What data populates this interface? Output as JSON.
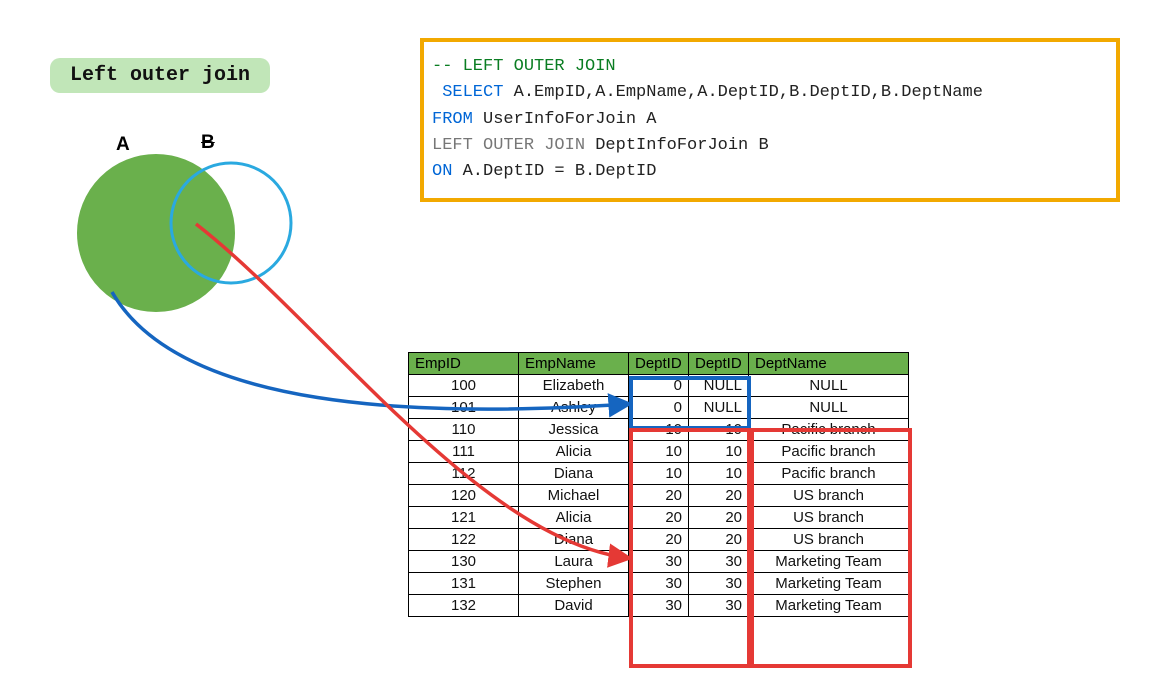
{
  "title": "Left outer join",
  "venn": {
    "labelA": "A",
    "labelB": "B"
  },
  "sql": {
    "comment": "-- LEFT OUTER JOIN",
    "select_kw": " SELECT",
    "select_cols": " A.EmpID,A.EmpName,A.DeptID,B.DeptID,B.DeptName",
    "from_kw": "FROM",
    "from_rest": " UserInfoForJoin A",
    "left_kw": "LEFT",
    "left_rest": " OUTER JOIN",
    "left_table": " DeptInfoForJoin B",
    "on_kw": "ON",
    "on_rest": " A.DeptID = B.DeptID"
  },
  "table": {
    "headers": {
      "c0": "EmpID",
      "c1": "EmpName",
      "c2": "DeptID",
      "c3": "DeptID",
      "c4": "DeptName"
    },
    "rows": [
      {
        "c0": "100",
        "c1": "Elizabeth",
        "c2": "0",
        "c3": "NULL",
        "c4": "NULL"
      },
      {
        "c0": "101",
        "c1": "Ashley",
        "c2": "0",
        "c3": "NULL",
        "c4": "NULL"
      },
      {
        "c0": "110",
        "c1": "Jessica",
        "c2": "10",
        "c3": "10",
        "c4": "Pacific branch"
      },
      {
        "c0": "111",
        "c1": "Alicia",
        "c2": "10",
        "c3": "10",
        "c4": "Pacific branch"
      },
      {
        "c0": "112",
        "c1": "Diana",
        "c2": "10",
        "c3": "10",
        "c4": "Pacific branch"
      },
      {
        "c0": "120",
        "c1": "Michael",
        "c2": "20",
        "c3": "20",
        "c4": "US branch"
      },
      {
        "c0": "121",
        "c1": "Alicia",
        "c2": "20",
        "c3": "20",
        "c4": "US branch"
      },
      {
        "c0": "122",
        "c1": "Diana",
        "c2": "20",
        "c3": "20",
        "c4": "US branch"
      },
      {
        "c0": "130",
        "c1": "Laura",
        "c2": "30",
        "c3": "30",
        "c4": "Marketing Team"
      },
      {
        "c0": "131",
        "c1": "Stephen",
        "c2": "30",
        "c3": "30",
        "c4": "Marketing Team"
      },
      {
        "c0": "132",
        "c1": "David",
        "c2": "30",
        "c3": "30",
        "c4": "Marketing Team"
      }
    ]
  }
}
